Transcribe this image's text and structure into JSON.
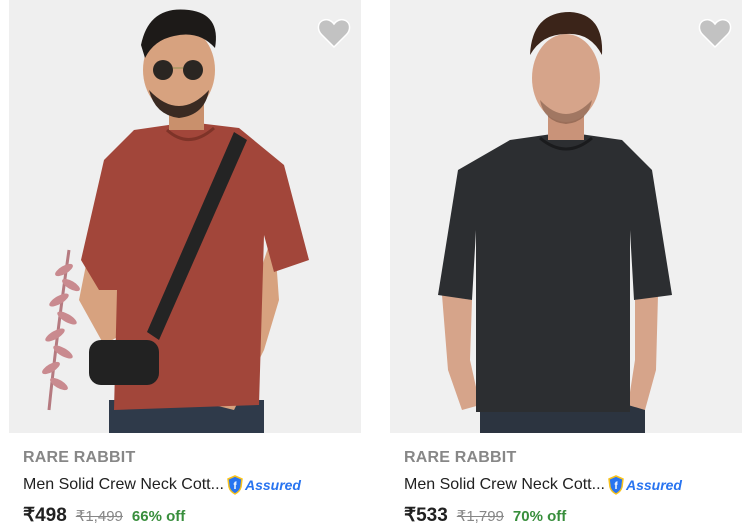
{
  "products": [
    {
      "brand": "RARE RABBIT",
      "title": "Men Solid Crew Neck Cott...",
      "assured_label": "Assured",
      "price": "₹498",
      "mrp": "₹1,499",
      "discount": "66% off",
      "tshirt_color": "#a2463a",
      "icon_wishlist": "heart-icon",
      "icon_assured": "assured-shield-icon"
    },
    {
      "brand": "RARE RABBIT",
      "title": "Men Solid Crew Neck Cott...",
      "assured_label": "Assured",
      "price": "₹533",
      "mrp": "₹1,799",
      "discount": "70% off",
      "tshirt_color": "#2c2e31",
      "icon_wishlist": "heart-icon",
      "icon_assured": "assured-shield-icon"
    }
  ],
  "colors": {
    "brand_grey": "#878787",
    "discount_green": "#388e3c",
    "assured_blue": "#2874f0",
    "wishlist_grey": "#c2c2c2"
  }
}
